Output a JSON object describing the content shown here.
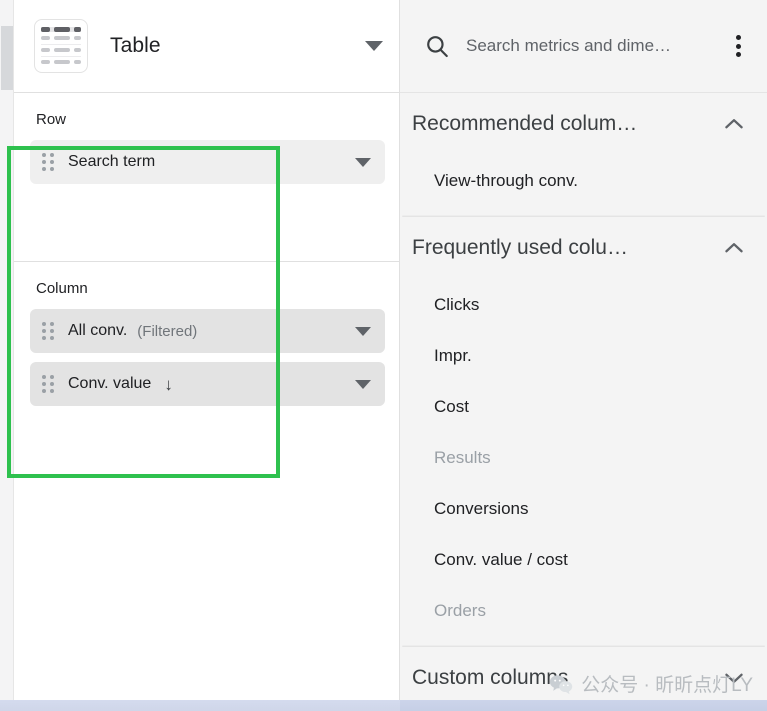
{
  "left_panel": {
    "visualization": {
      "icon": "table-icon",
      "label": "Table",
      "dropdown_icon": "caret-down-icon"
    },
    "sections": [
      {
        "label": "Row",
        "items": [
          {
            "drag_handle": "drag-handle-icon",
            "name": "Search term",
            "qualifier": "",
            "sort_icon": "",
            "dropdown_icon": "caret-down-icon"
          }
        ]
      },
      {
        "label": "Column",
        "items": [
          {
            "drag_handle": "drag-handle-icon",
            "name": "All conv.",
            "qualifier": "(Filtered)",
            "sort_icon": "",
            "dropdown_icon": "caret-down-icon"
          },
          {
            "drag_handle": "drag-handle-icon",
            "name": "Conv. value",
            "qualifier": "",
            "sort_icon": "↓",
            "dropdown_icon": "caret-down-icon"
          }
        ]
      }
    ],
    "annotation": {
      "type": "highlight-rectangle",
      "color": "#2ec14e"
    }
  },
  "right_panel": {
    "search": {
      "icon": "search-icon",
      "placeholder": "Search metrics and dime…",
      "overflow_menu_icon": "kebab-menu-icon"
    },
    "groups": [
      {
        "title": "Recommended colum…",
        "toggle_icon": "chevron-up-icon",
        "expanded": true,
        "options": [
          {
            "label": "View-through conv.",
            "disabled": false
          }
        ]
      },
      {
        "title": "Frequently used colu…",
        "toggle_icon": "chevron-up-icon",
        "expanded": true,
        "options": [
          {
            "label": "Clicks",
            "disabled": false
          },
          {
            "label": "Impr.",
            "disabled": false
          },
          {
            "label": "Cost",
            "disabled": false
          },
          {
            "label": "Results",
            "disabled": true
          },
          {
            "label": "Conversions",
            "disabled": false
          },
          {
            "label": "Conv. value / cost",
            "disabled": false
          },
          {
            "label": "Orders",
            "disabled": true
          }
        ]
      },
      {
        "title": "Custom columns",
        "toggle_icon": "chevron-down-icon",
        "expanded": false,
        "options": []
      }
    ],
    "watermark": {
      "icon": "wechat-icon",
      "text": "公众号 · 昕昕点灯LY"
    }
  },
  "scrollbar": {
    "orientation": "vertical",
    "position": "left"
  }
}
